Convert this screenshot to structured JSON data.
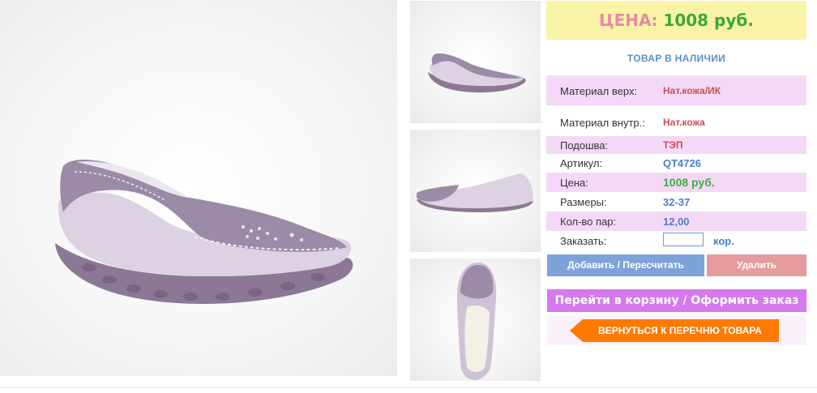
{
  "product": {
    "price_label": "ЦЕНА:",
    "price_value": "1008 руб.",
    "stock_status": "ТОВАР В НАЛИЧИИ"
  },
  "details": [
    {
      "label": "Материал верх:",
      "value": "Нат.кожа/ИК"
    },
    {
      "label": "Материал внутр.:",
      "value": "Нат.кожа"
    },
    {
      "label": "Подошва:",
      "value": "ТЭП"
    },
    {
      "label": "Артикул:",
      "value": "QT4726"
    },
    {
      "label": "Цена:",
      "value": "1008 руб."
    },
    {
      "label": "Размеры:",
      "value": "32-37"
    },
    {
      "label": "Кол-во пар:",
      "value": "12,00"
    }
  ],
  "order": {
    "label": "Заказать:",
    "quantity_value": "",
    "unit": "кор."
  },
  "buttons": {
    "add_recalc": "Добавить / Пересчитать",
    "delete": "Удалить",
    "go_to_cart": "Перейти в корзину / Оформить заказ",
    "back_to_list": "ВЕРНУТЬСЯ К ПЕРЕЧНЮ ТОВАРА"
  },
  "colors": {
    "price_box_bg": "#f9f3a6",
    "price_label": "#e68aa6",
    "price_value": "#3ca83a",
    "pink_row": "#f4d9f7",
    "add_button": "#7ea3db",
    "delete_button": "#e59a9c",
    "cart_button": "#d579ee",
    "back_button": "#ff7a00",
    "shoe_suede": "#9a8aa6",
    "shoe_leather": "#d9cfdf"
  },
  "images": {
    "main": "shoe-side-view",
    "thumbnails": [
      "shoe-side-view",
      "shoe-side-view-alt",
      "shoe-top-view"
    ]
  }
}
